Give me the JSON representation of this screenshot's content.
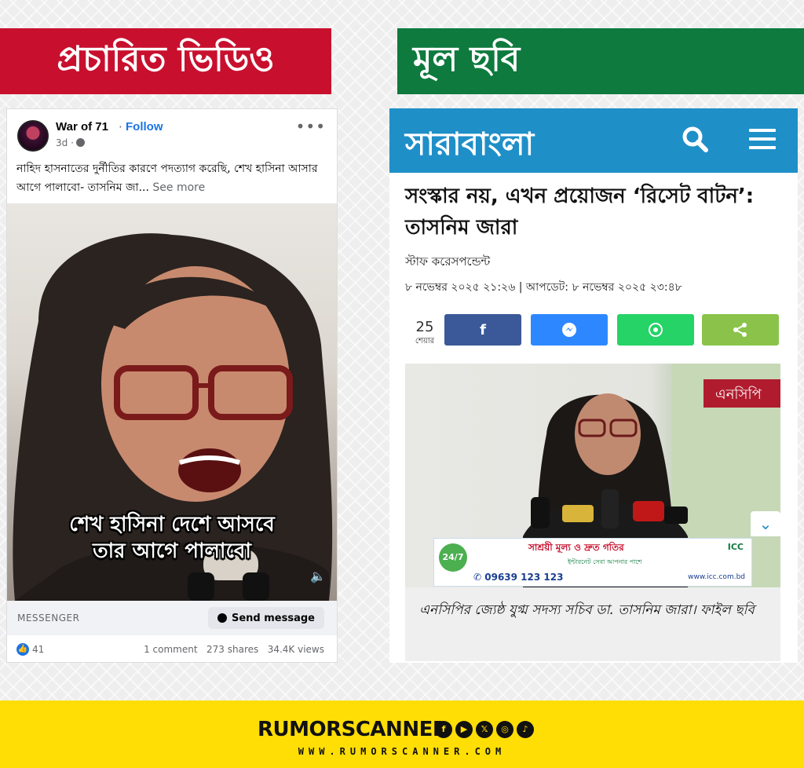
{
  "labels": {
    "left_banner": "প্রচারিত ভিডিও",
    "right_banner": "মূল ছবি"
  },
  "facebook_post": {
    "page_name": "War of 71",
    "separator": "·",
    "follow_label": "Follow",
    "time": "3d ·",
    "more_icon": "more-horizontal-icon",
    "text": "নাহিদ হাসনাতের দুর্নীতির কারণে পদত্যাগ করেছি, শেখ হাসিনা আসার আগে পালাবো- তাসনিম জা...",
    "see_more": "See more",
    "subtitle_line1": "শেখ হাসিনা দেশে আসবে",
    "subtitle_line2": "তার আগে পালাবো",
    "messenger_label": "MESSENGER",
    "send_message_label": "Send message",
    "likes": "41",
    "comments": "1 comment",
    "shares": "273 shares",
    "views": "34.4K views"
  },
  "news_article": {
    "site_logo": "সারাবাংলা",
    "headline": "সংস্কার নয়, এখন প্রয়োজন ‘রিসেট বাটন’: তাসনিম জারা",
    "byline": "স্টাফ করেসপন্ডেন্ট",
    "dateline": "৮ নভেম্বর ২০২৫ ২১:২৬ | আপডেট: ৮ নভেম্বর ২০২৫ ২৩:৪৮",
    "share_count": "25",
    "share_count_label": "শেয়ার",
    "share_buttons": [
      {
        "name": "facebook",
        "icon": "f",
        "color": "#3b5998"
      },
      {
        "name": "messenger",
        "icon": "⚡",
        "color": "#2d88ff"
      },
      {
        "name": "whatsapp",
        "icon": "✆",
        "color": "#25d366"
      },
      {
        "name": "share",
        "icon": "⋖",
        "color": "#8bc34a"
      }
    ],
    "ad": {
      "line1": "সাশ্রয়ী মূল্য ও দ্রুত গতির",
      "line2": "ইন্টারনেট সেবা আপনার পাশে",
      "phone": "09639 123 123",
      "website": "www.icc.com.bd",
      "badge": "24/7",
      "brand": "ICC"
    },
    "photo_banner_text": "এনসিপি",
    "caption": "এনসিপির জ্যেষ্ঠ যুগ্ম সদস্য সচিব ডা. তাসনিম জারা। ফাইল ছবি"
  },
  "footer": {
    "brand": "RUMORSCANNER",
    "website": "WWW.RUMORSCANNER.COM",
    "social_icons": [
      "facebook-icon",
      "youtube-icon",
      "x-icon",
      "instagram-icon",
      "tiktok-icon"
    ]
  }
}
